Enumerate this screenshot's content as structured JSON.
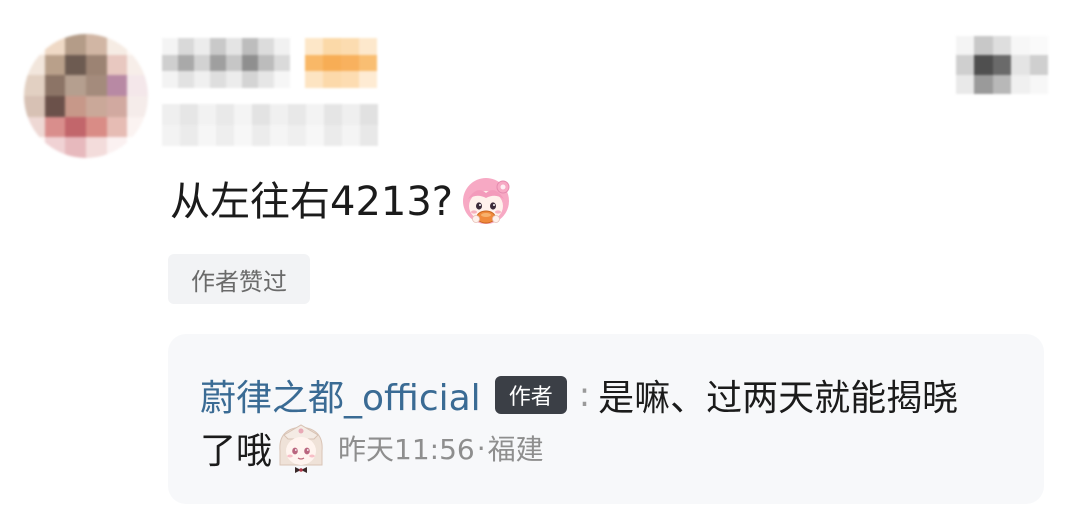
{
  "comment": {
    "text": "从左往右4213?",
    "sticker_icon": "pink-hair-girl-eating-sticker",
    "liked_tag": "作者赞过"
  },
  "reply": {
    "username": "蔚律之都_official",
    "author_badge": "作者",
    "colon": ":",
    "text_line1": "是嘛、过两天就能揭晓",
    "text_line2": "了哦",
    "sticker_icon": "beige-hair-girl-sticker",
    "time": "昨天11:56",
    "separator": "·",
    "location": "福建"
  },
  "colors": {
    "username": "#3a6b94",
    "badge_bg": "#3b3f46",
    "card_bg": "#f7f8fa",
    "tag_bg": "#f2f3f5"
  }
}
